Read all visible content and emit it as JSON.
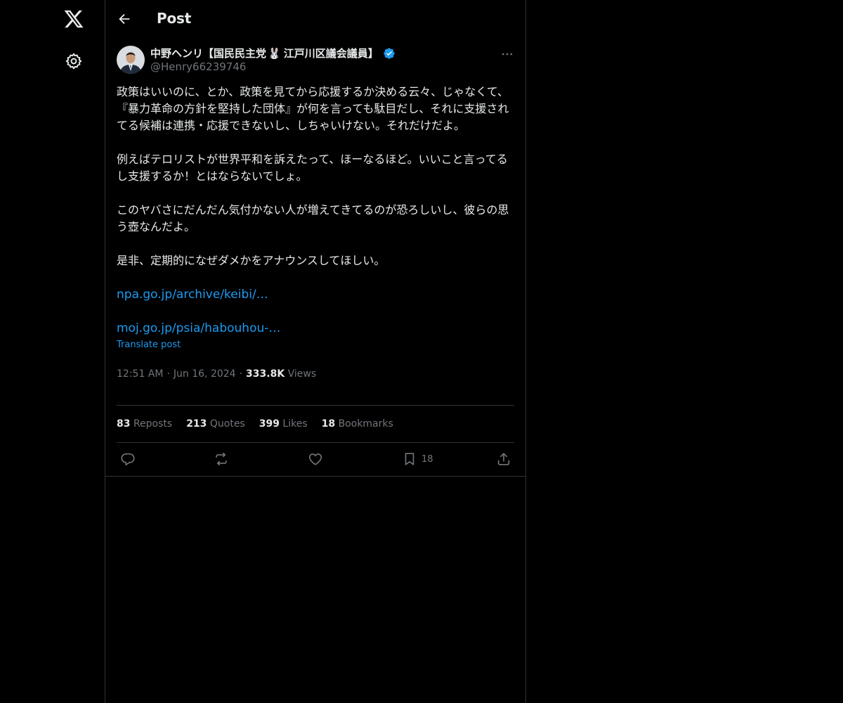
{
  "header": {
    "title": "Post"
  },
  "post": {
    "author": {
      "name": "中野ヘンリ【国民民主党",
      "name_emoji": "🐰",
      "name_suffix": "江戸川区議会議員】",
      "verified": true,
      "handle": "@Henry66239746"
    },
    "paragraphs": [
      "政策はいいのに、とか、政策を見てから応援するか決める云々、じゃなくて、『暴力革命の方針を堅持した団体』が何を言っても駄目だし、それに支援されてる候補は連携・応援できないし、しちゃいけない。それだけだよ。",
      "例えばテロリストが世界平和を訴えたって、ほーなるほど。いいこと言ってるし支援するか！とはならないでしょ。",
      "このヤバさにだんだん気付かない人が増えてきてるのが恐ろしいし、彼らの思う壺なんだよ。",
      "是非、定期的になぜダメかをアナウンスしてほしい。"
    ],
    "links": [
      "npa.go.jp/archive/keibi/…",
      "moj.go.jp/psia/habouhou-…"
    ],
    "translate_label": "Translate post",
    "time": "12:51 AM",
    "date": "Jun 16, 2024",
    "views_count": "333.8K",
    "views_label": "Views"
  },
  "stats": {
    "reposts": {
      "count": "83",
      "label": "Reposts"
    },
    "quotes": {
      "count": "213",
      "label": "Quotes"
    },
    "likes": {
      "count": "399",
      "label": "Likes"
    },
    "bookmarks": {
      "count": "18",
      "label": "Bookmarks"
    }
  },
  "actions": {
    "reply_icon": "reply-icon",
    "repost_icon": "repost-icon",
    "like_icon": "heart-icon",
    "bookmark_icon": "bookmark-icon",
    "bookmark_count": "18",
    "share_icon": "share-icon"
  },
  "colors": {
    "background": "#000000",
    "text": "#e7e9ea",
    "muted": "#71767b",
    "accent": "#1d9bf0",
    "border": "#2f3336"
  }
}
